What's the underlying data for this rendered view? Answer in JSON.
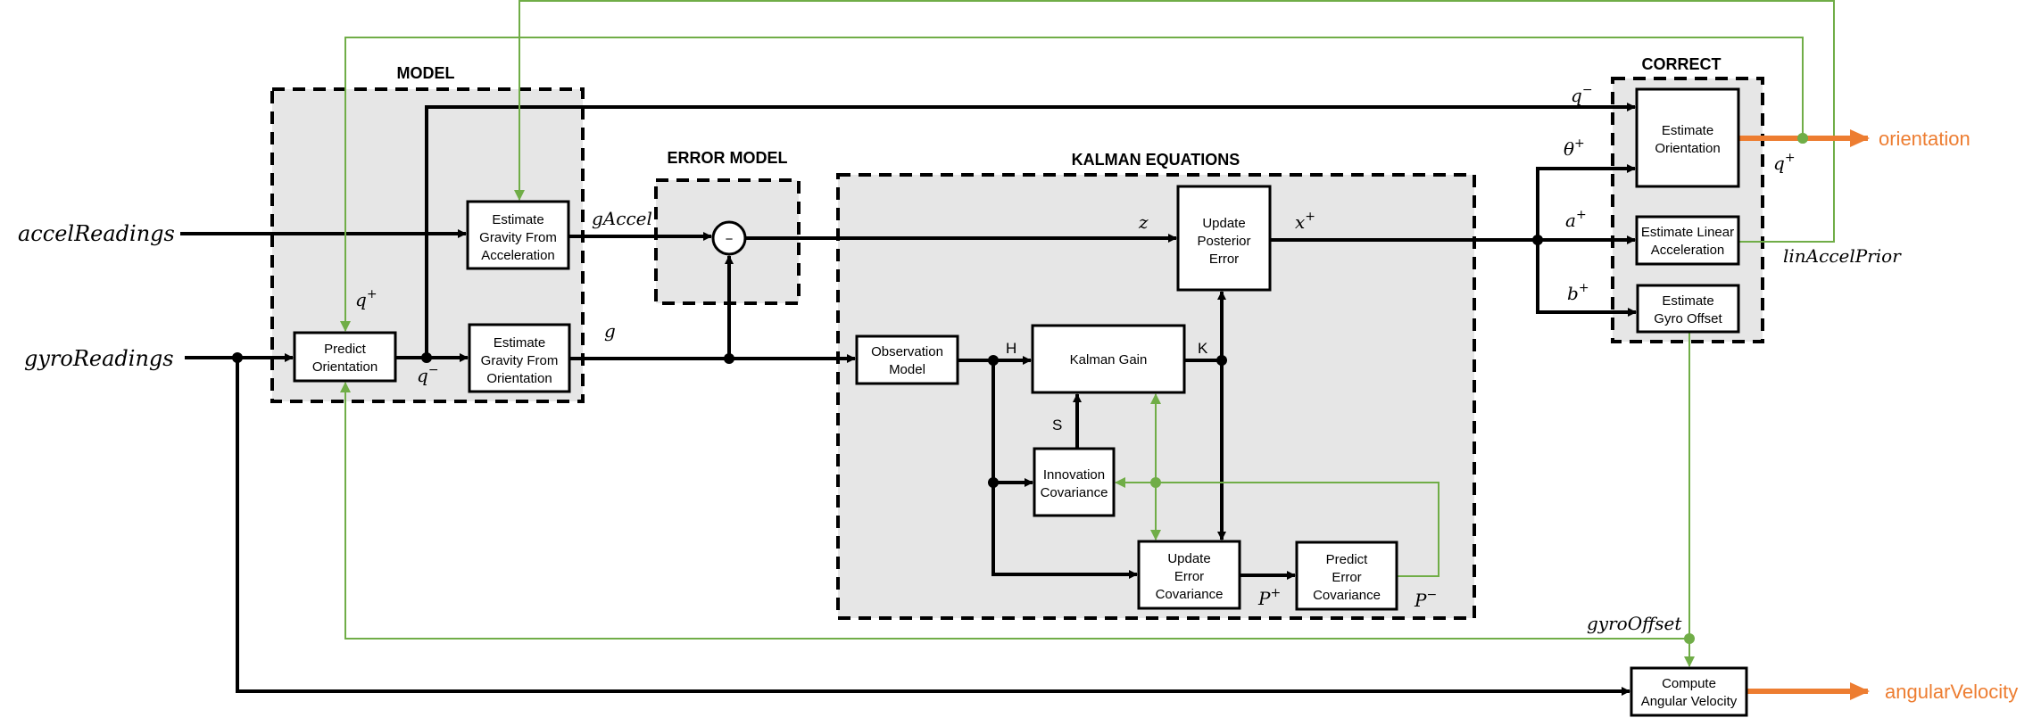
{
  "colors": {
    "feedback": "#70ad47",
    "output": "#ed7d31",
    "group_fill": "#e6e6e6",
    "wire": "#000000"
  },
  "inputs": {
    "accel": "accelReadings",
    "gyro": "gyroReadings"
  },
  "outputs": {
    "orientation": "orientation",
    "angular_velocity": "angularVelocity"
  },
  "groups": {
    "model": "MODEL",
    "error_model": "ERROR MODEL",
    "kalman": "KALMAN EQUATIONS",
    "correct": "CORRECT"
  },
  "blocks": {
    "predict_orientation": [
      "Predict",
      "Orientation"
    ],
    "gravity_from_accel": [
      "Estimate",
      "Gravity From",
      "Acceleration"
    ],
    "gravity_from_orient": [
      "Estimate",
      "Gravity From",
      "Orientation"
    ],
    "subtract_symbol": "−",
    "observation_model": [
      "Observation",
      "Model"
    ],
    "kalman_gain": [
      "Kalman Gain"
    ],
    "update_posterior_error": [
      "Update",
      "Posterior",
      "Error"
    ],
    "innovation_covariance": [
      "Innovation",
      "Covariance"
    ],
    "update_error_covariance": [
      "Update",
      "Error",
      "Covariance"
    ],
    "predict_error_covariance": [
      "Predict",
      "Error",
      "Covariance"
    ],
    "estimate_orientation": [
      "Estimate",
      "Orientation"
    ],
    "estimate_linear_accel": [
      "Estimate Linear",
      "Acceleration"
    ],
    "estimate_gyro_offset": [
      "Estimate",
      "Gyro Offset"
    ],
    "compute_angular_velocity": [
      "Compute",
      "Angular Velocity"
    ]
  },
  "signals": {
    "q_plus_in": {
      "base": "q",
      "sup": "+"
    },
    "q_minus_model": {
      "base": "q",
      "sup": "−"
    },
    "g_accel": {
      "base": "gAccel",
      "sup": ""
    },
    "g": {
      "base": "g",
      "sup": ""
    },
    "z": {
      "base": "z",
      "sup": ""
    },
    "x_plus": {
      "base": "x",
      "sup": "+"
    },
    "q_minus_correct": {
      "base": "q",
      "sup": "−"
    },
    "theta_plus": {
      "base": "θ",
      "sup": "+"
    },
    "a_plus": {
      "base": "a",
      "sup": "+"
    },
    "b_plus": {
      "base": "b",
      "sup": "+"
    },
    "q_plus_out": {
      "base": "q",
      "sup": "+"
    },
    "lin_accel_prior": {
      "base": "linAccelPrior",
      "sup": ""
    },
    "gyro_offset": {
      "base": "gyroOffset",
      "sup": ""
    },
    "p_plus": {
      "base": "P",
      "sup": "+"
    },
    "p_minus": {
      "base": "P",
      "sup": "−"
    },
    "H": "H",
    "K": "K",
    "S": "S"
  }
}
